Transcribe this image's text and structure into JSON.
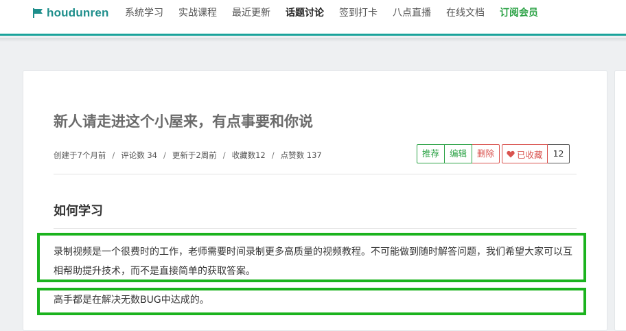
{
  "header": {
    "logo_text": "houdunren",
    "logo_icon": "flag-icon",
    "brand_color": "#1e8e8b",
    "nav": [
      {
        "label": "系统学习",
        "active": false
      },
      {
        "label": "实战课程",
        "active": false
      },
      {
        "label": "最近更新",
        "active": false
      },
      {
        "label": "话题讨论",
        "active": true
      },
      {
        "label": "签到打卡",
        "active": false
      },
      {
        "label": "八点直播",
        "active": false
      },
      {
        "label": "在线文档",
        "active": false
      },
      {
        "label": "订阅会员",
        "active": false
      }
    ]
  },
  "topic": {
    "title": "新人请走进这个小屋来，有点事要和你说",
    "meta": {
      "created": "创建于7个月前",
      "comments": "评论数 34",
      "updated": "更新于2周前",
      "favorites": "收藏数12",
      "likes": "点赞数 137",
      "separator": "/"
    },
    "actions": {
      "recommend": "推荐",
      "edit": "编辑",
      "delete": "删除",
      "favorited": "已收藏",
      "favorite_count": "12"
    },
    "section_heading": "如何学习",
    "paragraphs": [
      "录制视频是一个很费时的工作，老师需要时间录制更多高质量的视频教程。不可能做到随时解答问题，我们希望大家可以互相帮助提升技术，而不是直接简单的获取答案。",
      "高手都是在解决无数BUG中达成的。"
    ]
  },
  "colors": {
    "accent_green": "#2ba245",
    "danger_red": "#d9534f",
    "highlight_box": "#1bb31e",
    "topbar_border": "#1aa39b"
  }
}
